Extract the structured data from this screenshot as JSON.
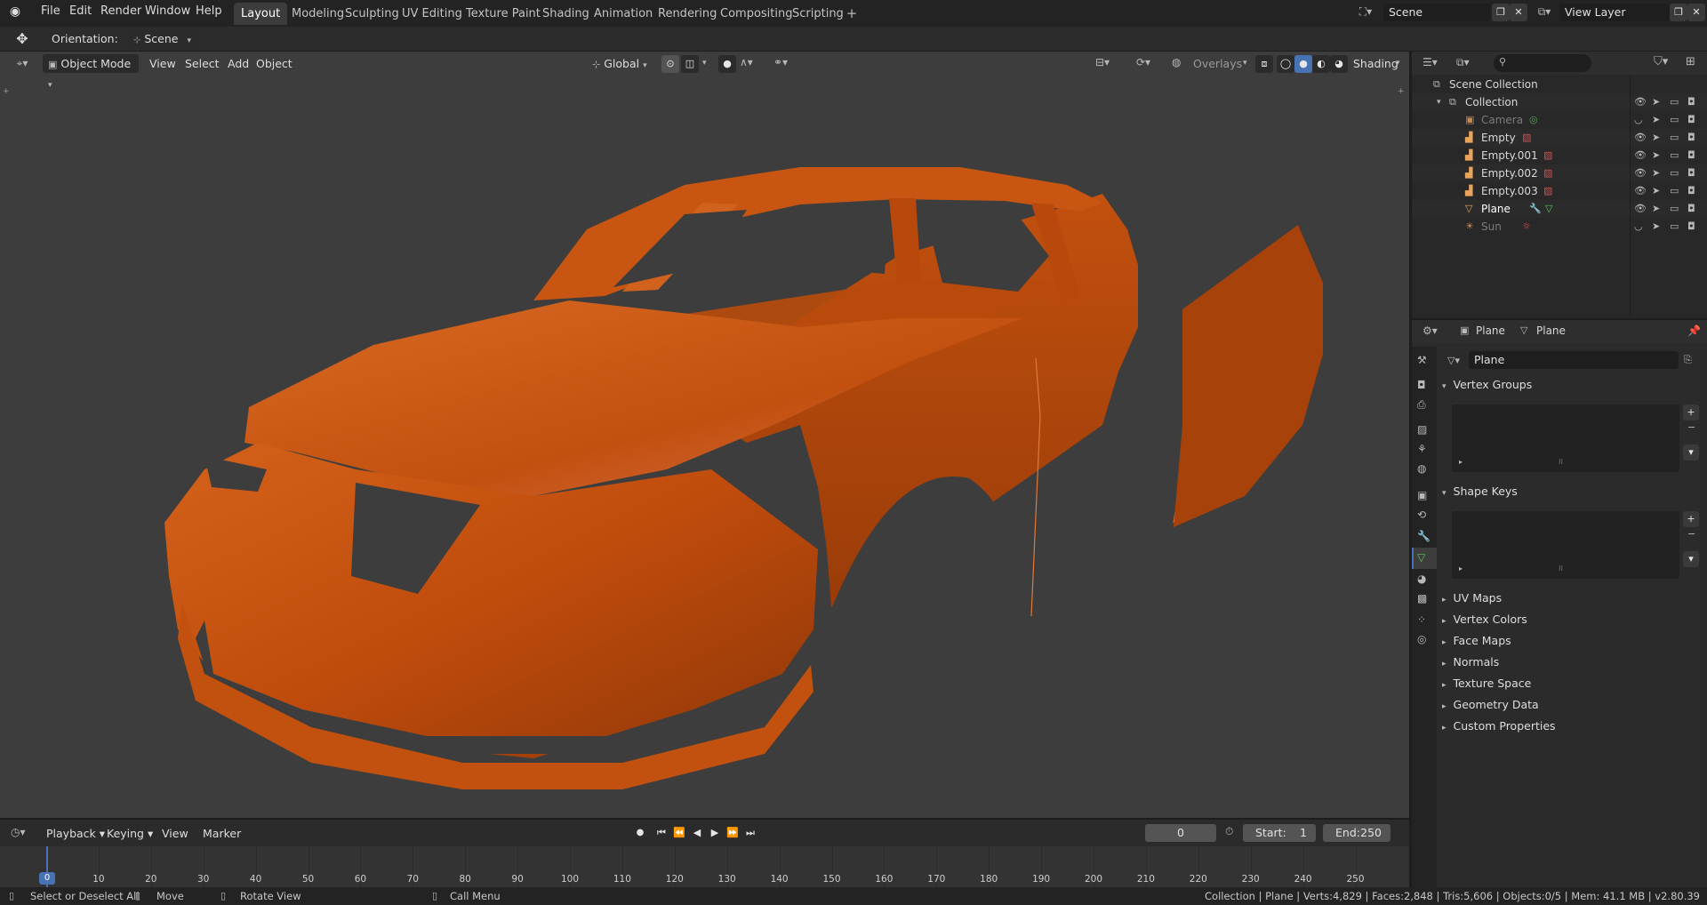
{
  "menubar": {
    "items": [
      "File",
      "Edit",
      "Render",
      "Window",
      "Help"
    ],
    "workspaces": [
      "Layout",
      "Modeling",
      "Sculpting",
      "UV Editing",
      "Texture Paint",
      "Shading",
      "Animation",
      "Rendering",
      "Compositing",
      "Scripting"
    ],
    "active_workspace": "Layout",
    "scene_name": "Scene",
    "view_layer_name": "View Layer"
  },
  "tool_settings": {
    "orientation_label": "Orientation:",
    "orientation_value": "Scene"
  },
  "viewport_header": {
    "mode": "Object Mode",
    "menus": [
      "View",
      "Select",
      "Add",
      "Object"
    ],
    "transform_orientation": "Global",
    "overlays_label": "Overlays",
    "shading_label": "Shading"
  },
  "outliner": {
    "root": "Scene Collection",
    "collection": "Collection",
    "objects": [
      {
        "name": "Camera",
        "type": "camera",
        "dimmed": true,
        "visible": false
      },
      {
        "name": "Empty",
        "type": "empty",
        "dimmed": false,
        "visible": true
      },
      {
        "name": "Empty.001",
        "type": "empty",
        "dimmed": false,
        "visible": true
      },
      {
        "name": "Empty.002",
        "type": "empty",
        "dimmed": false,
        "visible": true
      },
      {
        "name": "Empty.003",
        "type": "empty",
        "dimmed": false,
        "visible": true
      },
      {
        "name": "Plane",
        "type": "mesh",
        "dimmed": false,
        "visible": true,
        "active": true
      },
      {
        "name": "Sun",
        "type": "light",
        "dimmed": true,
        "visible": false
      }
    ]
  },
  "properties": {
    "breadcrumb_object": "Plane",
    "breadcrumb_data": "Plane",
    "mesh_name": "Plane",
    "expanded_panels": [
      "Vertex Groups",
      "Shape Keys"
    ],
    "collapsed_panels": [
      "UV Maps",
      "Vertex Colors",
      "Face Maps",
      "Normals",
      "Texture Space",
      "Geometry Data",
      "Custom Properties"
    ]
  },
  "timeline": {
    "menus": [
      "Playback",
      "Keying",
      "View",
      "Marker"
    ],
    "current_frame": "0",
    "start_label": "Start:",
    "start_value": "1",
    "end_label": "End:",
    "end_value": "250",
    "ruler_ticks": [
      "0",
      "10",
      "20",
      "30",
      "40",
      "50",
      "60",
      "70",
      "80",
      "90",
      "100",
      "110",
      "120",
      "130",
      "140",
      "150",
      "160",
      "170",
      "180",
      "190",
      "200",
      "210",
      "220",
      "230",
      "240",
      "250"
    ]
  },
  "statusbar": {
    "hint_select": "Select or Deselect All",
    "hint_move": "Move",
    "hint_rotate": "Rotate View",
    "hint_menu": "Call Menu",
    "stats": "Collection | Plane | Verts:4,829 | Faces:2,848 | Tris:5,606 | Objects:0/5 | Mem: 41.1 MB | v2.80.39"
  },
  "colors": {
    "car_body": "#c9500f",
    "viewport_bg": "#3d3d3d",
    "accent_blue": "#4772b3",
    "empty_icon": "#e8a45c"
  }
}
